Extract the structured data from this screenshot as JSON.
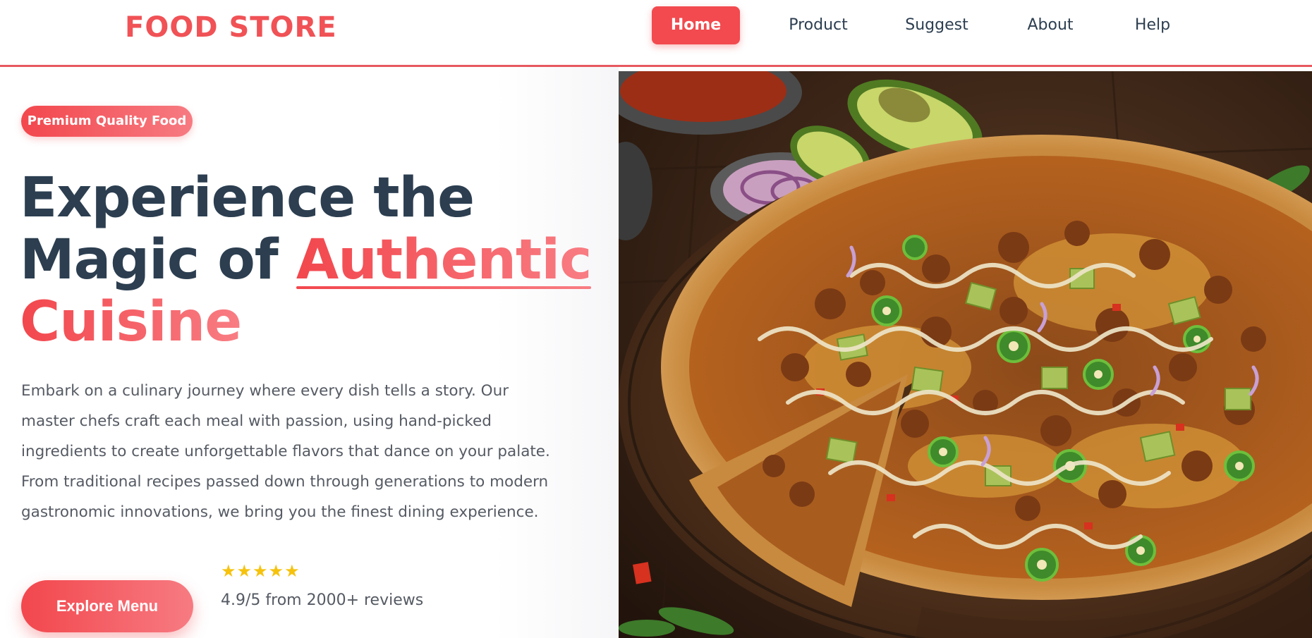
{
  "header": {
    "brand": "FOOD STORE",
    "nav": [
      {
        "label": "Home",
        "active": true
      },
      {
        "label": "Product",
        "active": false
      },
      {
        "label": "Suggest",
        "active": false
      },
      {
        "label": "About",
        "active": false
      },
      {
        "label": "Help",
        "active": false
      }
    ]
  },
  "hero": {
    "badge": "Premium Quality Food",
    "headline": {
      "line1": "Experience the",
      "line2_start": "Magic of ",
      "line2_accent": "Authentic",
      "line3_accent": "Cuisine"
    },
    "description": "Embark on a culinary journey where every dish tells a story. Our master chefs craft each meal with passion, using hand-picked ingredients to create unforgettable flavors that dance on your palate. From traditional recipes passed down through generations to modern gastronomic innovations, we bring you the finest dining experience.",
    "cta_label": "Explore Menu",
    "rating": {
      "stars": "★★★★★",
      "text": "4.9/5 from 2000+ reviews",
      "value": 4.9
    },
    "image_icon": "pizza-photo"
  },
  "colors": {
    "accent": "#f24a4f",
    "heading": "#2c3e50",
    "body_text": "#555a63",
    "star": "#f6c20d"
  }
}
